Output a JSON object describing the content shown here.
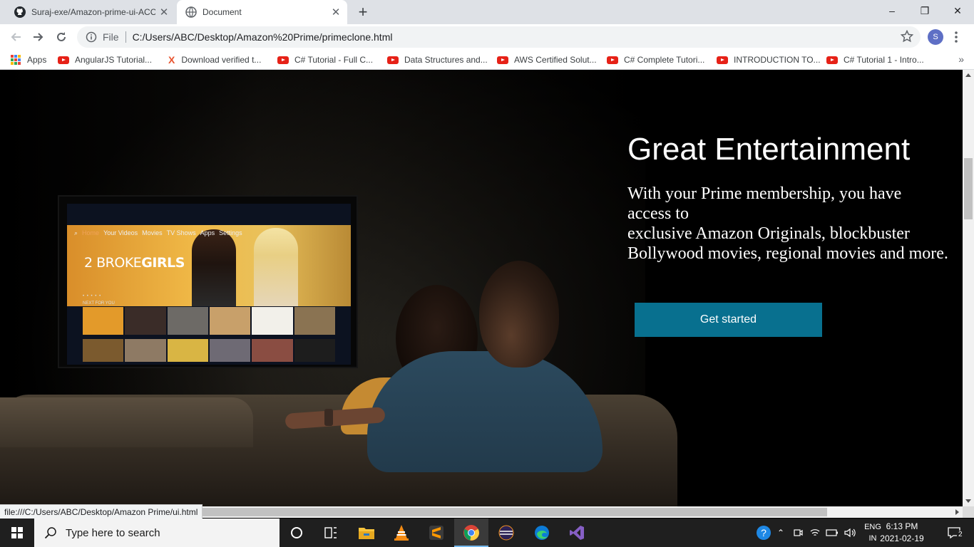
{
  "browser": {
    "tabs": [
      {
        "title": "Suraj-exe/Amazon-prime-ui-ACC",
        "close": "✕"
      },
      {
        "title": "Document",
        "close": "✕"
      }
    ],
    "new_tab": "+",
    "window_controls": {
      "minimize": "–",
      "restore": "❐",
      "close": "✕"
    },
    "address": {
      "scheme": "File",
      "url": "C:/Users/ABC/Desktop/Amazon%20Prime/primeclone.html"
    },
    "profile_initial": "S",
    "bookmarks": [
      {
        "label": "Apps",
        "icon": "apps-grid-icon"
      },
      {
        "label": "AngularJS Tutorial...",
        "icon": "youtube-icon"
      },
      {
        "label": "Download verified t...",
        "icon": "x-icon"
      },
      {
        "label": "C# Tutorial - Full C...",
        "icon": "youtube-icon"
      },
      {
        "label": "Data Structures and...",
        "icon": "youtube-icon"
      },
      {
        "label": "AWS Certified Solut...",
        "icon": "youtube-icon"
      },
      {
        "label": "C# Complete Tutori...",
        "icon": "youtube-icon"
      },
      {
        "label": "INTRODUCTION TO...",
        "icon": "youtube-icon"
      },
      {
        "label": "C# Tutorial 1 - Intro...",
        "icon": "youtube-icon"
      }
    ],
    "bookmarks_more": "»",
    "status_url": "file:///C:/Users/ABC/Desktop/Amazon Prime/ui.html"
  },
  "page": {
    "hero_title": "Great Entertainment",
    "hero_subtitle_lines": [
      "With your Prime membership, you have",
      "access to",
      "exclusive Amazon Originals, blockbuster",
      "Bollywood movies, regional movies and more."
    ],
    "cta_label": "Get started",
    "tv_screen": {
      "nav": [
        "Home",
        "Your Videos",
        "Movies",
        "TV Shows",
        "Apps",
        "Settings"
      ],
      "show_title_light": "2 BROKE",
      "show_title_bold": "GIRLS",
      "next_label": "NEXT FOR YOU"
    }
  },
  "taskbar": {
    "search_placeholder": "Type here to search",
    "language_top": "ENG",
    "language_bottom": "IN",
    "time": "6:13 PM",
    "date": "2021-02-19",
    "notification_count": "2"
  }
}
